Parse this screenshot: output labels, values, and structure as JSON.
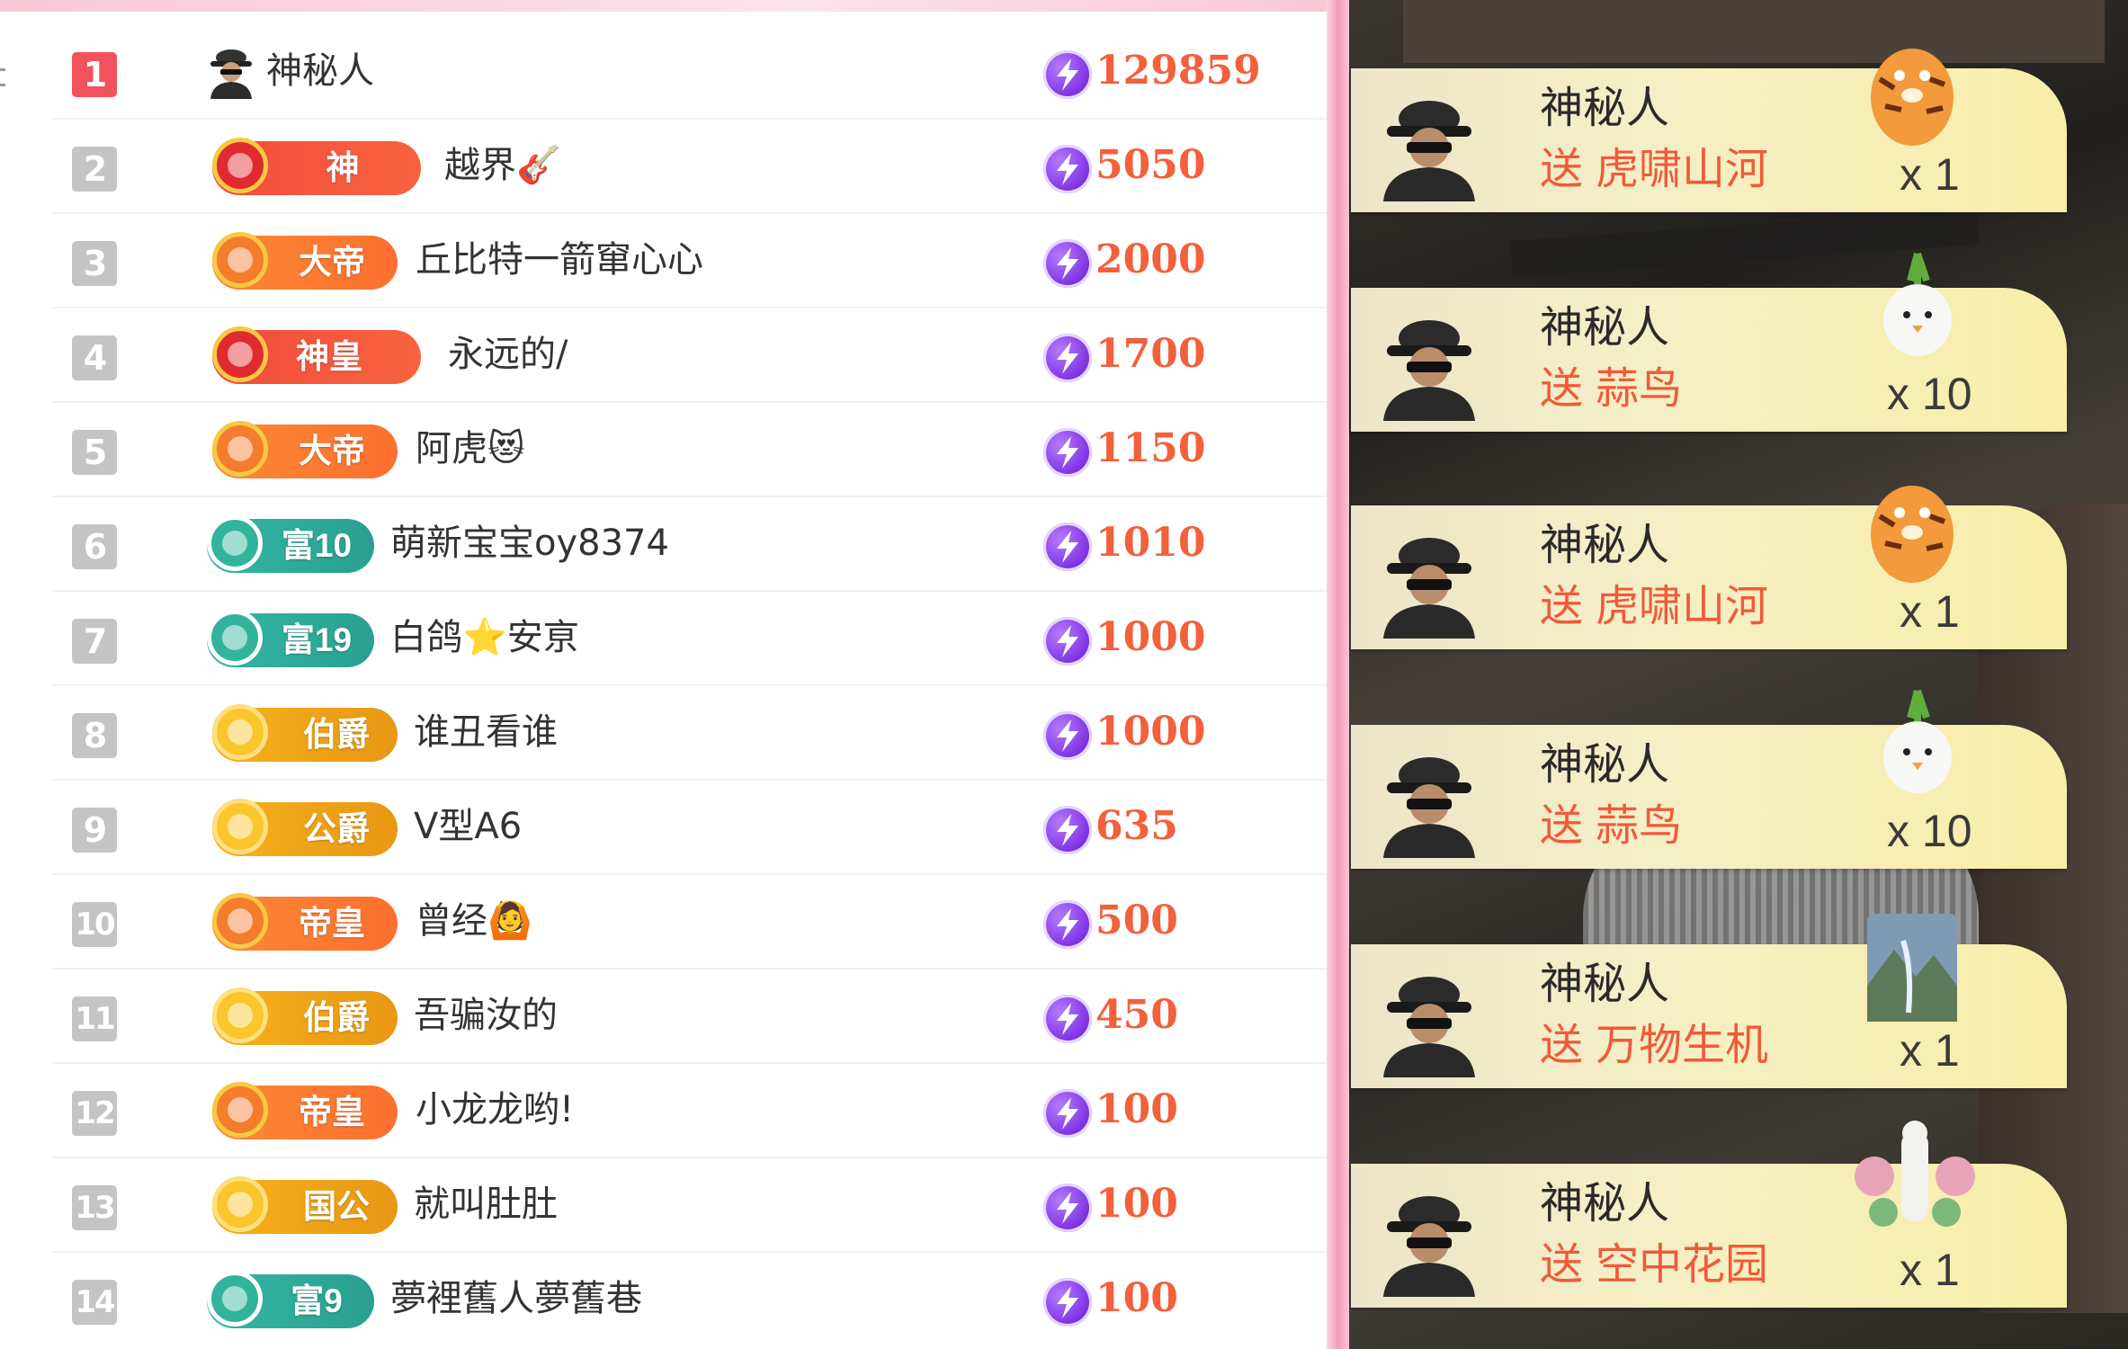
{
  "leaderboard": {
    "rows": [
      {
        "rank": "1",
        "badge": "",
        "badge_style": "none",
        "name": "神秘人",
        "score": "129859"
      },
      {
        "rank": "2",
        "badge": "神",
        "badge_style": "red",
        "name": "越界🎸",
        "score": "5050"
      },
      {
        "rank": "3",
        "badge": "大帝",
        "badge_style": "orange",
        "name": "丘比特一箭窜心心",
        "score": "2000"
      },
      {
        "rank": "4",
        "badge": "神皇",
        "badge_style": "red",
        "name": "永远的/",
        "score": "1700"
      },
      {
        "rank": "5",
        "badge": "大帝",
        "badge_style": "orange",
        "name": "阿虎😻",
        "score": "1150"
      },
      {
        "rank": "6",
        "badge": "富10",
        "badge_style": "teal",
        "name": "萌新宝宝oy8374",
        "score": "1010"
      },
      {
        "rank": "7",
        "badge": "富19",
        "badge_style": "teal",
        "name": "白鸽⭐安亰",
        "score": "1000"
      },
      {
        "rank": "8",
        "badge": "伯爵",
        "badge_style": "gold",
        "name": "谁丑看谁",
        "score": "1000"
      },
      {
        "rank": "9",
        "badge": "公爵",
        "badge_style": "gold",
        "name": "V型A6",
        "score": "635"
      },
      {
        "rank": "10",
        "badge": "帝皇",
        "badge_style": "orange",
        "name": "曾经🙆",
        "score": "500"
      },
      {
        "rank": "11",
        "badge": "伯爵",
        "badge_style": "gold",
        "name": "吾骗汝的",
        "score": "450"
      },
      {
        "rank": "12",
        "badge": "帝皇",
        "badge_style": "orange",
        "name": "小龙龙哟!",
        "score": "100"
      },
      {
        "rank": "13",
        "badge": "国公",
        "badge_style": "gold",
        "name": "就叫肚肚",
        "score": "100"
      },
      {
        "rank": "14",
        "badge": "富9",
        "badge_style": "teal",
        "name": "夢裡舊人夢舊巷",
        "score": "100"
      }
    ]
  },
  "gift_feed": {
    "items": [
      {
        "sender": "神秘人",
        "verb": "送",
        "gift": "虎啸山河",
        "count": "x 1",
        "gift_icon": "tiger-gift-icon"
      },
      {
        "sender": "神秘人",
        "verb": "送",
        "gift": "蒜鸟",
        "count": "x 10",
        "gift_icon": "garlic-bird-gift-icon"
      },
      {
        "sender": "神秘人",
        "verb": "送",
        "gift": "虎啸山河",
        "count": "x 1",
        "gift_icon": "tiger-gift-icon"
      },
      {
        "sender": "神秘人",
        "verb": "送",
        "gift": "蒜鸟",
        "count": "x 10",
        "gift_icon": "garlic-bird-gift-icon"
      },
      {
        "sender": "神秘人",
        "verb": "送",
        "gift": "万物生机",
        "count": "x 1",
        "gift_icon": "landscape-gift-icon"
      },
      {
        "sender": "神秘人",
        "verb": "送",
        "gift": "空中花园",
        "count": "x 1",
        "gift_icon": "sky-garden-gift-icon"
      }
    ]
  },
  "colors": {
    "score_text": "#f2603c",
    "rank_first_bg": "#f2525b",
    "rank_default_bg": "#c4c4c4",
    "divider_pink": "#f49ab7",
    "gift_card_bg": "#f5efc7",
    "gift_text": "#f05a3a",
    "coin_purple": "#7b2fe0"
  }
}
